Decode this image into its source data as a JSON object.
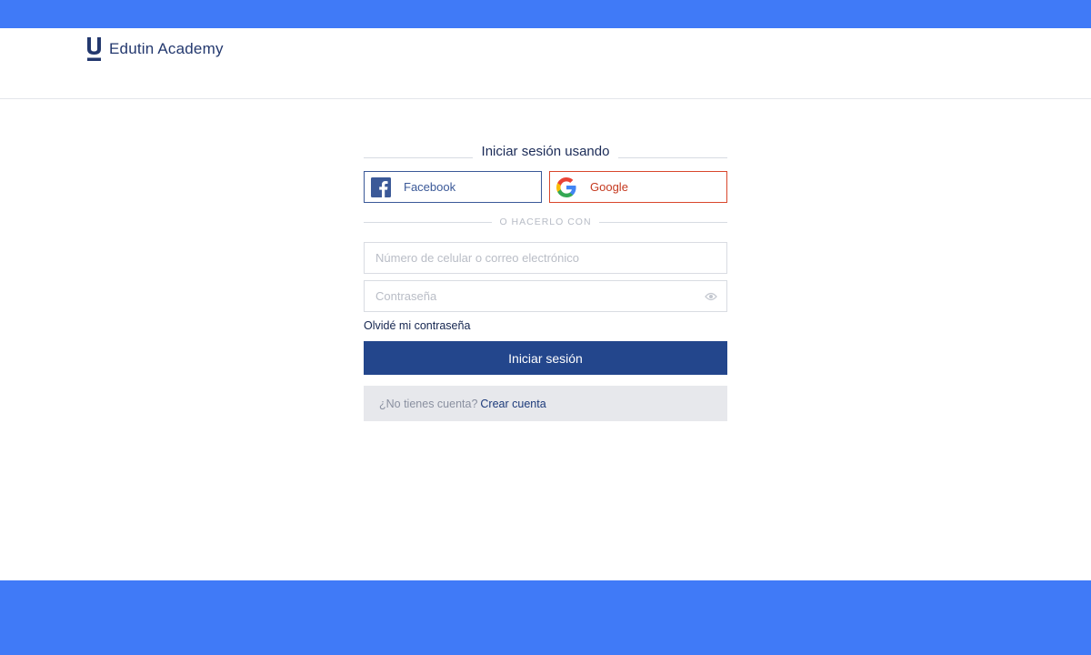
{
  "colors": {
    "band": "#407af7",
    "brand": "#23386e",
    "primary_button": "#23468c",
    "facebook": "#3b5998",
    "google": "#d9472c"
  },
  "header": {
    "logo_icon": "u-logo-icon",
    "brand_name": "Edutin Academy"
  },
  "login": {
    "title": "Iniciar sesión usando",
    "social": {
      "facebook_label": "Facebook",
      "facebook_icon": "facebook-icon",
      "google_label": "Google",
      "google_icon": "google-icon"
    },
    "or_text": "O HACERLO CON",
    "user_field": {
      "placeholder": "Número de celular o correo electrónico",
      "value": ""
    },
    "password_field": {
      "placeholder": "Contraseña",
      "value": "",
      "toggle_icon": "eye-icon"
    },
    "forgot_link": "Olvidé mi contraseña",
    "submit_label": "Iniciar sesión",
    "signup_question": "¿No tienes cuenta?",
    "signup_link": "Crear cuenta"
  }
}
